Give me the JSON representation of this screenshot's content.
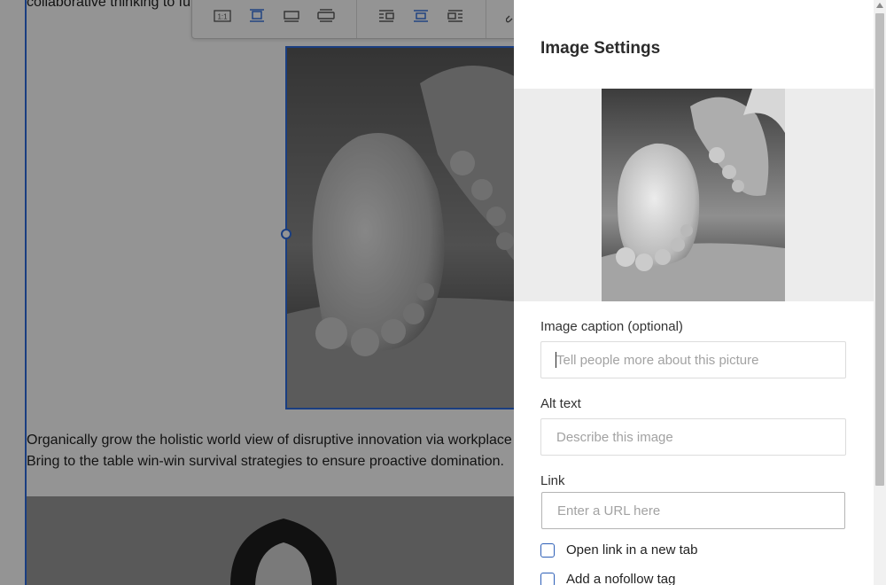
{
  "editor": {
    "top_text_line1": "",
    "top_text_line2": "collaborative thinking to fu",
    "paragraph_line1": "Organically grow the holistic world view of disruptive innovation via workplace",
    "paragraph_line2": "Bring to the table win-win survival strategies to ensure proactive domination.",
    "toolbar": {
      "original_size_label": "1:1",
      "icons": [
        "original-size-icon",
        "align-center-frame-icon",
        "wide-width-icon",
        "full-width-icon",
        "wrap-left-icon",
        "center-wrap-icon",
        "wrap-right-icon",
        "link-icon"
      ]
    }
  },
  "panel": {
    "title": "Image Settings",
    "caption": {
      "label": "Image caption (optional)",
      "placeholder": "Tell people more about this picture",
      "value": ""
    },
    "alt": {
      "label": "Alt text",
      "placeholder": "Describe this image",
      "value": ""
    },
    "link": {
      "label": "Link",
      "placeholder": "Enter a URL here",
      "value": ""
    },
    "checkboxes": [
      {
        "label": "Open link in a new tab",
        "checked": false
      },
      {
        "label": "Add a nofollow tag",
        "checked": false
      }
    ]
  },
  "colors": {
    "accent": "#2d6cdf",
    "overlay": "rgba(0,0,0,0.42)",
    "preview_bg": "#ececec",
    "checkbox_border": "#2d5fb7"
  }
}
